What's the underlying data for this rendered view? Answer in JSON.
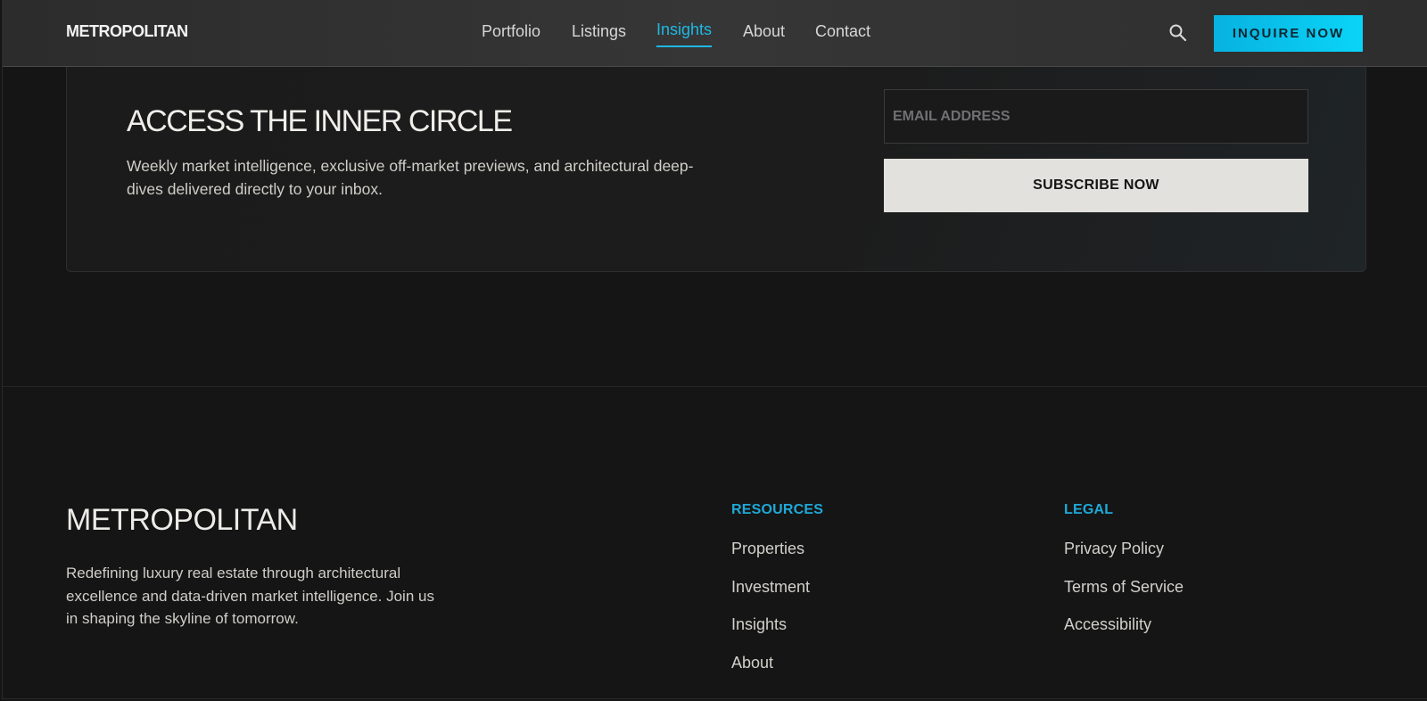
{
  "header": {
    "logo": "METROPOLITAN",
    "nav": [
      {
        "label": "Portfolio"
      },
      {
        "label": "Listings"
      },
      {
        "label": "Insights",
        "active": true
      },
      {
        "label": "About"
      },
      {
        "label": "Contact"
      }
    ],
    "search_icon": "search-icon",
    "cta_label": "INQUIRE NOW"
  },
  "newsletter": {
    "title": "ACCESS THE INNER CIRCLE",
    "description": "Weekly market intelligence, exclusive off-market previews, and architectural deep-dives delivered directly to your inbox.",
    "email_placeholder": "EMAIL ADDRESS",
    "email_value": "",
    "subscribe_label": "SUBSCRIBE NOW"
  },
  "footer": {
    "logo": "METROPOLITAN",
    "description": "Redefining luxury real estate through architectural excellence and data-driven market intelligence. Join us in shaping the skyline of tomorrow.",
    "columns": [
      {
        "title": "RESOURCES",
        "links": [
          "Properties",
          "Investment",
          "Insights",
          "About"
        ]
      },
      {
        "title": "LEGAL",
        "links": [
          "Privacy Policy",
          "Terms of Service",
          "Accessibility"
        ]
      }
    ]
  },
  "colors": {
    "accent": "#1fb8e3",
    "cta_gradient_start": "#08b2e0",
    "cta_gradient_end": "#0ad4f8",
    "background": "#151515",
    "header": "#333333",
    "subscribe_button": "#e3e1dd"
  }
}
